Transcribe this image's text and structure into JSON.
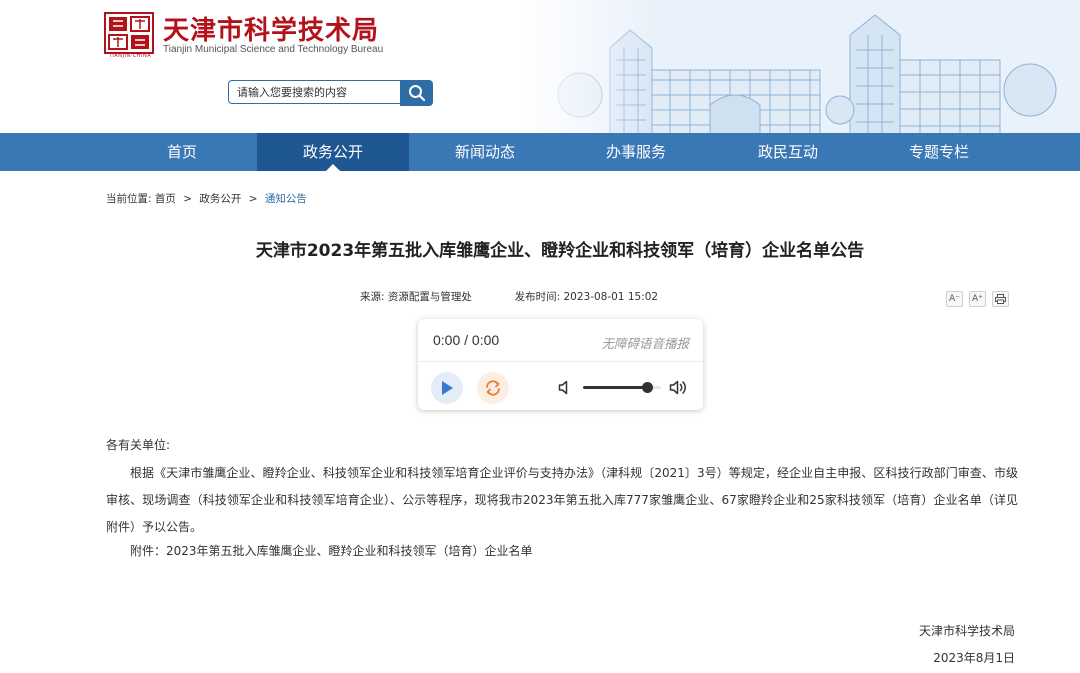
{
  "header": {
    "title": "天津市科学技术局",
    "subtitle": "Tianjin Municipal Science and Technology Bureau",
    "seal_text": "天津",
    "seal_caption": "TIANJIN·CHINA",
    "search_placeholder": "请输入您要搜索的内容"
  },
  "nav": {
    "items": [
      {
        "label": "首页"
      },
      {
        "label": "政务公开",
        "active": true
      },
      {
        "label": "新闻动态"
      },
      {
        "label": "办事服务"
      },
      {
        "label": "政民互动"
      },
      {
        "label": "专题专栏"
      }
    ]
  },
  "breadcrumb": {
    "prefix": "当前位置:",
    "items": [
      "首页",
      "政务公开",
      "通知公告"
    ],
    "separator": ">"
  },
  "article": {
    "title": "天津市2023年第五批入库雏鹰企业、瞪羚企业和科技领军（培育）企业名单公告",
    "source_label": "来源:",
    "source": "资源配置与管理处",
    "date_label": "发布时间:",
    "date": "2023-08-01 15:02",
    "tools": {
      "font_smaller": "A⁻",
      "font_larger": "A⁺",
      "print": "print-icon"
    },
    "salutation": "各有关单位:",
    "paragraph": "根据《天津市雏鹰企业、瞪羚企业、科技领军企业和科技领军培育企业评价与支持办法》（津科规〔2021〕3号）等规定，经企业自主申报、区科技行政部门审查、市级审核、现场调查（科技领军企业和科技领军培育企业）、公示等程序，现将我市2023年第五批入库777家雏鹰企业、67家瞪羚企业和25家科技领军（培育）企业名单（详见附件）予以公告。",
    "attachment": "附件：2023年第五批入库雏鹰企业、瞪羚企业和科技领军（培育）企业名单",
    "signature_org": "天津市科学技术局",
    "signature_date": "2023年8月1日"
  },
  "player": {
    "time": "0:00 / 0:00",
    "label": "无障碍语音播报",
    "volume": 0.82
  },
  "colors": {
    "brand_red": "#b3121b",
    "nav_blue": "#3a78b5",
    "nav_active": "#1f5793",
    "link_blue": "#2f6da5"
  }
}
